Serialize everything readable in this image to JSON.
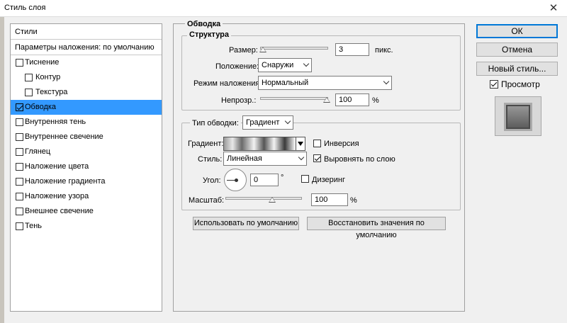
{
  "window": {
    "title": "Стиль слоя",
    "close_glyph": "✕"
  },
  "sidebar": {
    "header": "Стили",
    "blend_options": "Параметры наложения: по умолчанию",
    "items": [
      {
        "label": "Тиснение",
        "checked": false,
        "sub": false
      },
      {
        "label": "Контур",
        "checked": false,
        "sub": true
      },
      {
        "label": "Текстура",
        "checked": false,
        "sub": true
      },
      {
        "label": "Обводка",
        "checked": true,
        "sub": false,
        "selected": true
      },
      {
        "label": "Внутренняя тень",
        "checked": false,
        "sub": false
      },
      {
        "label": "Внутреннее свечение",
        "checked": false,
        "sub": false
      },
      {
        "label": "Глянец",
        "checked": false,
        "sub": false
      },
      {
        "label": "Наложение цвета",
        "checked": false,
        "sub": false
      },
      {
        "label": "Наложение градиента",
        "checked": false,
        "sub": false
      },
      {
        "label": "Наложение узора",
        "checked": false,
        "sub": false
      },
      {
        "label": "Внешнее свечение",
        "checked": false,
        "sub": false
      },
      {
        "label": "Тень",
        "checked": false,
        "sub": false
      }
    ]
  },
  "stroke": {
    "section_title": "Обводка",
    "structure_title": "Структура",
    "size_label": "Размер:",
    "size_value": "3",
    "size_unit": "пикс.",
    "size_slider_fraction": 0.0,
    "position_label": "Положение:",
    "position_value": "Снаружи",
    "blend_mode_label": "Режим наложения:",
    "blend_mode_value": "Нормальный",
    "opacity_label": "Непрозр.:",
    "opacity_value": "100",
    "opacity_unit": "%",
    "opacity_slider_fraction": 1.0,
    "fill_type_label": "Тип обводки:",
    "fill_type_value": "Градиент",
    "gradient_label": "Градиент:",
    "reverse_label": "Инверсия",
    "reverse_checked": false,
    "style_label": "Стиль:",
    "style_value": "Линейная",
    "align_label": "Выровнять по слою",
    "align_checked": true,
    "angle_label": "Угол:",
    "angle_value": "0",
    "angle_unit": "°",
    "dither_label": "Дизеринг",
    "dither_checked": false,
    "scale_label": "Масштаб:",
    "scale_value": "100",
    "scale_unit": "%",
    "scale_slider_fraction": 0.5,
    "make_default_label": "Использовать по умолчанию",
    "reset_default_label": "Восстановить значения по умолчанию"
  },
  "actions": {
    "ok_label": "ОК",
    "cancel_label": "Отмена",
    "new_style_label": "Новый стиль...",
    "preview_label": "Просмотр",
    "preview_checked": true
  },
  "colors": {
    "selection": "#3399ff",
    "default_button_border": "#0078d7"
  }
}
